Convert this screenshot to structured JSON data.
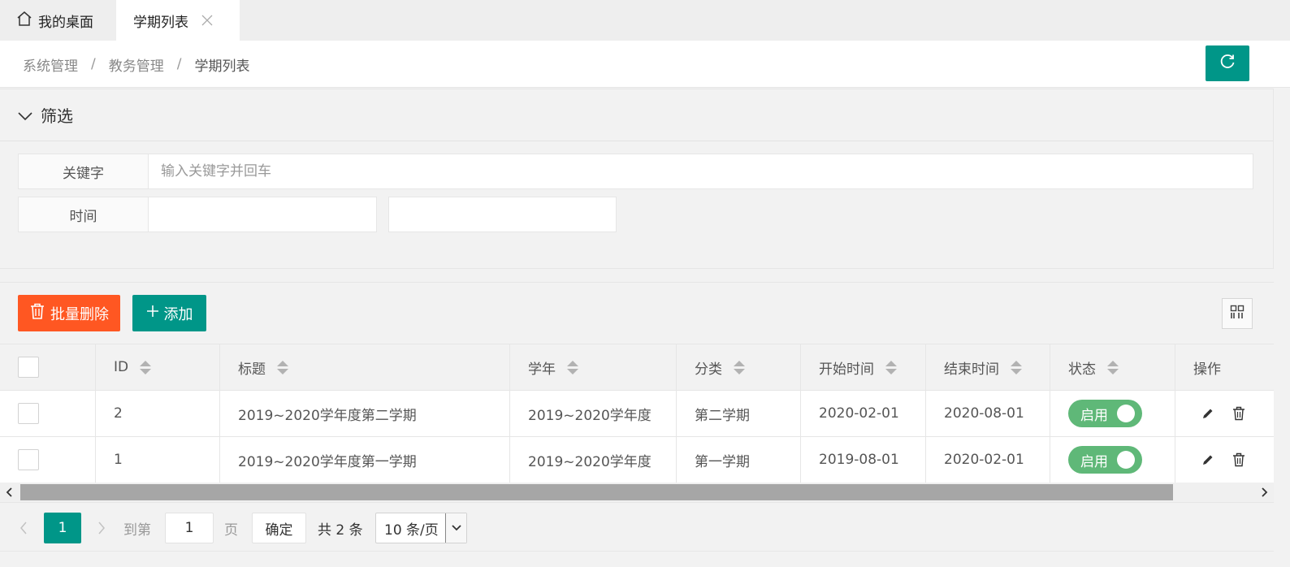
{
  "tabs": {
    "home_label": "我的桌面",
    "active_label": "学期列表"
  },
  "breadcrumb": {
    "items": [
      "系统管理",
      "教务管理",
      "学期列表"
    ],
    "separator": "/"
  },
  "filter": {
    "title": "筛选",
    "keyword_label": "关键字",
    "keyword_placeholder": "输入关键字并回车",
    "keyword_value": "",
    "time_label": "时间",
    "time_start_value": "",
    "time_end_value": ""
  },
  "toolbar": {
    "batch_delete_label": "批量删除",
    "add_label": "添加"
  },
  "table": {
    "columns": [
      "ID",
      "标题",
      "学年",
      "分类",
      "开始时间",
      "结束时间",
      "状态",
      "操作"
    ],
    "rows": [
      {
        "id": "2",
        "title": "2019~2020学年度第二学期",
        "year": "2019~2020学年度",
        "category": "第二学期",
        "start": "2020-02-01",
        "end": "2020-08-01",
        "status": "启用"
      },
      {
        "id": "1",
        "title": "2019~2020学年度第一学期",
        "year": "2019~2020学年度",
        "category": "第一学期",
        "start": "2019-08-01",
        "end": "2020-02-01",
        "status": "启用"
      }
    ]
  },
  "pager": {
    "current_page": "1",
    "goto_label": "到第",
    "goto_value": "1",
    "page_label": "页",
    "confirm_label": "确定",
    "total_label": "共 2 条",
    "page_size_label": "10 条/页"
  },
  "colors": {
    "primary": "#009688",
    "danger": "#ff5722",
    "switch_on": "#5fb878"
  }
}
